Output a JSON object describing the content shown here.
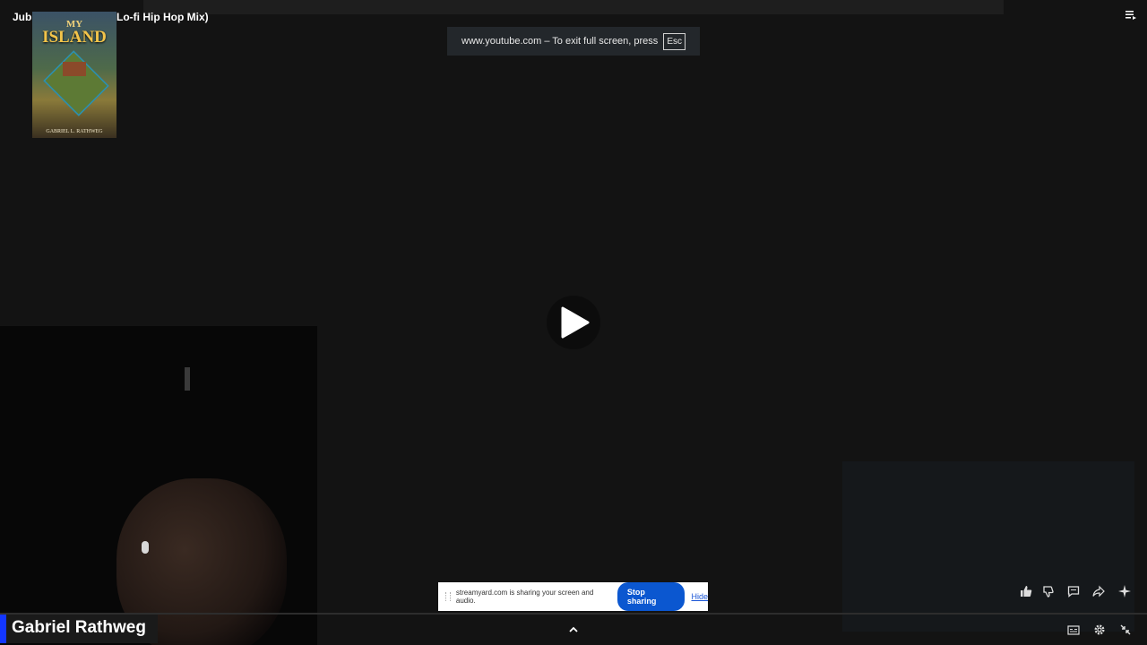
{
  "video": {
    "title_left": "Jubi",
    "title_right": "Lo-fi Hip Hop Mix)"
  },
  "book_cover": {
    "title_top": "MY",
    "title_main": "ISLAND",
    "author": "GABRIEL L. RATHWEG"
  },
  "fullscreen_notice": {
    "text": "www.youtube.com – To exit full screen, press",
    "key": "Esc"
  },
  "webcam": {
    "name": "Gabriel Rathweg",
    "accent_color": "#1336ff"
  },
  "share_bar": {
    "message": "streamyard.com is sharing your screen and audio.",
    "stop_label": "Stop sharing",
    "hide_label": "Hide"
  },
  "icons": {
    "playlist": "playlist-icon",
    "play": "play-icon",
    "like": "thumbs-up-icon",
    "dislike": "thumbs-down-icon",
    "comments": "comment-icon",
    "share": "share-icon",
    "ask": "sparkle-icon",
    "expand": "chevron-up-icon",
    "captions": "captions-icon",
    "settings": "gear-icon",
    "exit_fullscreen": "exit-fullscreen-icon"
  }
}
